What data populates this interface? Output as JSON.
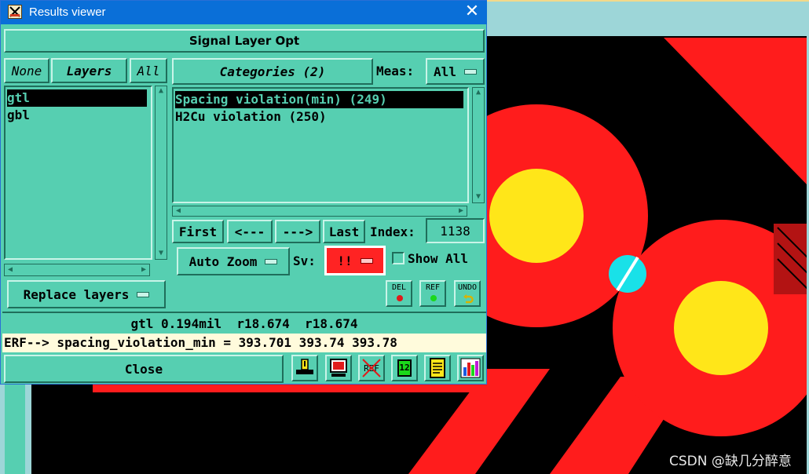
{
  "window": {
    "title": "Results viewer",
    "close_glyph": "✕",
    "header": "Signal Layer Opt"
  },
  "layers": {
    "none_label": "None",
    "header": "Layers",
    "all_label": "All",
    "items": [
      {
        "label": "gtl",
        "selected": true
      },
      {
        "label": "gbl",
        "selected": false
      }
    ],
    "replace_label": "Replace layers"
  },
  "categories": {
    "header": "Categories (2)",
    "meas_label": "Meas:",
    "meas_value": "All",
    "items": [
      {
        "label": "Spacing violation(min) (249)",
        "selected": true
      },
      {
        "label": "H2Cu violation (250)",
        "selected": false
      }
    ]
  },
  "nav": {
    "first": "First",
    "prev": "<---",
    "next": "--->",
    "last": "Last",
    "index_label": "Index:",
    "index_value": "1138"
  },
  "options": {
    "auto_zoom": "Auto Zoom",
    "sv_label": "Sv:",
    "sv_value": "!!",
    "show_all": "Show All"
  },
  "action_buttons": {
    "del": "DEL",
    "ref": "REF",
    "undo": "UNDO"
  },
  "status": {
    "line": "gtl 0.194mil  r18.674  r18.674",
    "erf": "ERF--> spacing_violation_min = 393.701 393.74 393.78"
  },
  "footer": {
    "close": "Close",
    "ref_icon_text": "REF",
    "one_two_text": "12"
  },
  "watermark": "CSDN @缺几分醉意",
  "colors": {
    "panel": "#56cfb1",
    "title_bar": "#0a6fd8",
    "pad_red": "#ff1c1c",
    "pad_yellow": "#ffe619",
    "marker_cyan": "#19e1e8",
    "erf_bg": "#fffbdc"
  }
}
